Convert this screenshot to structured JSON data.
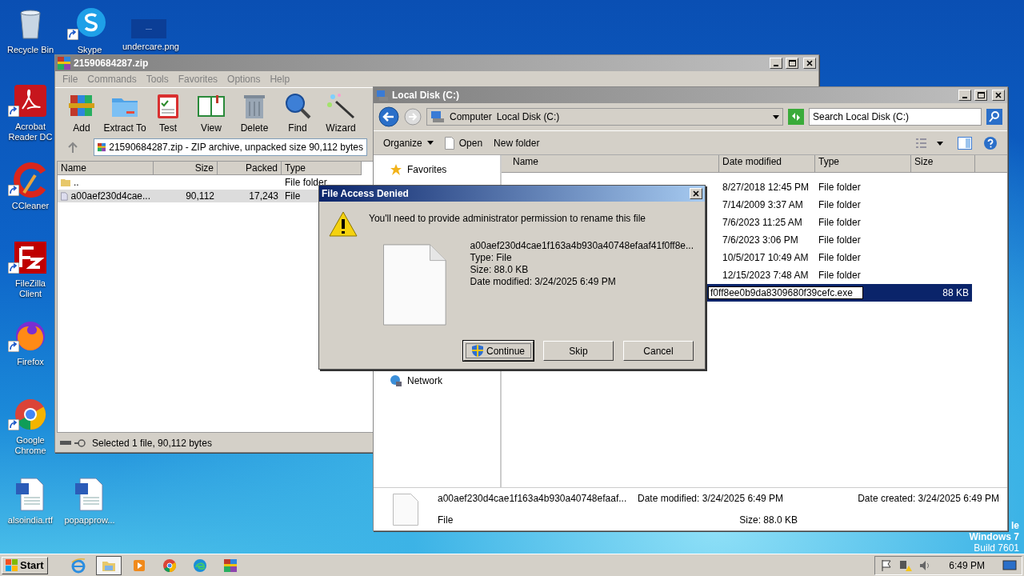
{
  "desktop": {
    "icons": [
      {
        "label": "Recycle Bin",
        "kind": "recycle",
        "shortcut": false
      },
      {
        "label": "Skype",
        "kind": "skype",
        "shortcut": true
      },
      {
        "label": "undercare.png",
        "kind": "image",
        "shortcut": false
      },
      {
        "label": "Acrobat Reader DC",
        "kind": "acrobat",
        "shortcut": true
      },
      {
        "label": "CCleaner",
        "kind": "ccleaner",
        "shortcut": true
      },
      {
        "label": "FileZilla Client",
        "kind": "filezilla",
        "shortcut": true
      },
      {
        "label": "Firefox",
        "kind": "firefox",
        "shortcut": true
      },
      {
        "label": "Google Chrome",
        "kind": "chrome",
        "shortcut": true
      },
      {
        "label": "alsoindia.rtf",
        "kind": "word",
        "shortcut": false
      },
      {
        "label": "popapprow...",
        "kind": "word",
        "shortcut": false
      }
    ],
    "watermark": [
      "le",
      "Windows 7",
      "Build 7601"
    ]
  },
  "archive_window": {
    "title": "21590684287.zip",
    "menu": [
      "File",
      "Commands",
      "Tools",
      "Favorites",
      "Options",
      "Help"
    ],
    "toolbar": [
      {
        "label": "Add",
        "kind": "add"
      },
      {
        "label": "Extract To",
        "kind": "extract"
      },
      {
        "label": "Test",
        "kind": "test"
      },
      {
        "label": "View",
        "kind": "view"
      },
      {
        "label": "Delete",
        "kind": "delete"
      },
      {
        "label": "Find",
        "kind": "find"
      },
      {
        "label": "Wizard",
        "kind": "wizard"
      }
    ],
    "address": "21590684287.zip - ZIP archive, unpacked size 90,112 bytes",
    "columns": [
      "Name",
      "Size",
      "Packed",
      "Type"
    ],
    "rows": [
      {
        "kind": "folder",
        "name": "..",
        "size": "",
        "packed": "",
        "type": "File folder",
        "selected": false
      },
      {
        "kind": "file",
        "name": "a00aef230d4cae...",
        "size": "90,112",
        "packed": "17,243",
        "type": "File",
        "selected": true
      }
    ],
    "status": "Selected 1 file, 90,112 bytes"
  },
  "explorer_window": {
    "title": "Local Disk (C:)",
    "breadcrumb": [
      "Computer",
      "Local Disk (C:)"
    ],
    "search": {
      "placeholder": "Search Local Disk (C:)"
    },
    "commands": [
      {
        "label": "Organize",
        "kind": "menu"
      },
      {
        "label": "Open",
        "kind": "open"
      },
      {
        "label": "New folder",
        "kind": "plain"
      }
    ],
    "nav": [
      {
        "label": "Favorites",
        "kind": "star"
      },
      {
        "label": "Network",
        "kind": "network"
      }
    ],
    "columns": [
      "Name",
      "Date modified",
      "Type",
      "Size"
    ],
    "rows": [
      {
        "date": "8/27/2018 12:45 PM",
        "type": "File folder",
        "selected": false
      },
      {
        "date": "7/14/2009 3:37 AM",
        "type": "File folder",
        "selected": false
      },
      {
        "date": "7/6/2023 11:25 AM",
        "type": "File folder",
        "selected": false
      },
      {
        "date": "7/6/2023 3:06 PM",
        "type": "File folder",
        "selected": false
      },
      {
        "date": "10/5/2017 10:49 AM",
        "type": "File folder",
        "selected": false
      },
      {
        "date": "12/15/2023 7:48 AM",
        "type": "File folder",
        "selected": false
      },
      {
        "rename": "f0ff8ee0b9da8309680f39cefc.exe",
        "size": "88 KB",
        "selected": true
      }
    ],
    "details": {
      "name": "a00aef230d4cae1f163a4b930a40748efaaf...",
      "type": "File",
      "date_modified": "Date modified: 3/24/2025 6:49 PM",
      "size": "Size: 88.0 KB",
      "date_created": "Date created: 3/24/2025 6:49 PM"
    }
  },
  "dialog": {
    "title": "File Access Denied",
    "message": "You'll need to provide administrator permission to rename this file",
    "file": {
      "name": "a00aef230d4cae1f163a4b930a40748efaaf41f0ff8e...",
      "type": "Type: File",
      "size": "Size: 88.0 KB",
      "date_modified": "Date modified: 3/24/2025 6:49 PM"
    },
    "buttons": [
      {
        "label": "Continue",
        "default": true,
        "shield": true
      },
      {
        "label": "Skip",
        "default": false,
        "shield": false
      },
      {
        "label": "Cancel",
        "default": false,
        "shield": false
      }
    ]
  },
  "taskbar": {
    "start": "Start",
    "apps": [
      {
        "kind": "ie",
        "selected": false
      },
      {
        "kind": "explorer",
        "selected": true
      },
      {
        "kind": "media",
        "selected": false
      },
      {
        "kind": "chrome",
        "selected": false
      },
      {
        "kind": "edge",
        "selected": false
      },
      {
        "kind": "winrar",
        "selected": false
      }
    ],
    "clock": "6:49 PM"
  }
}
